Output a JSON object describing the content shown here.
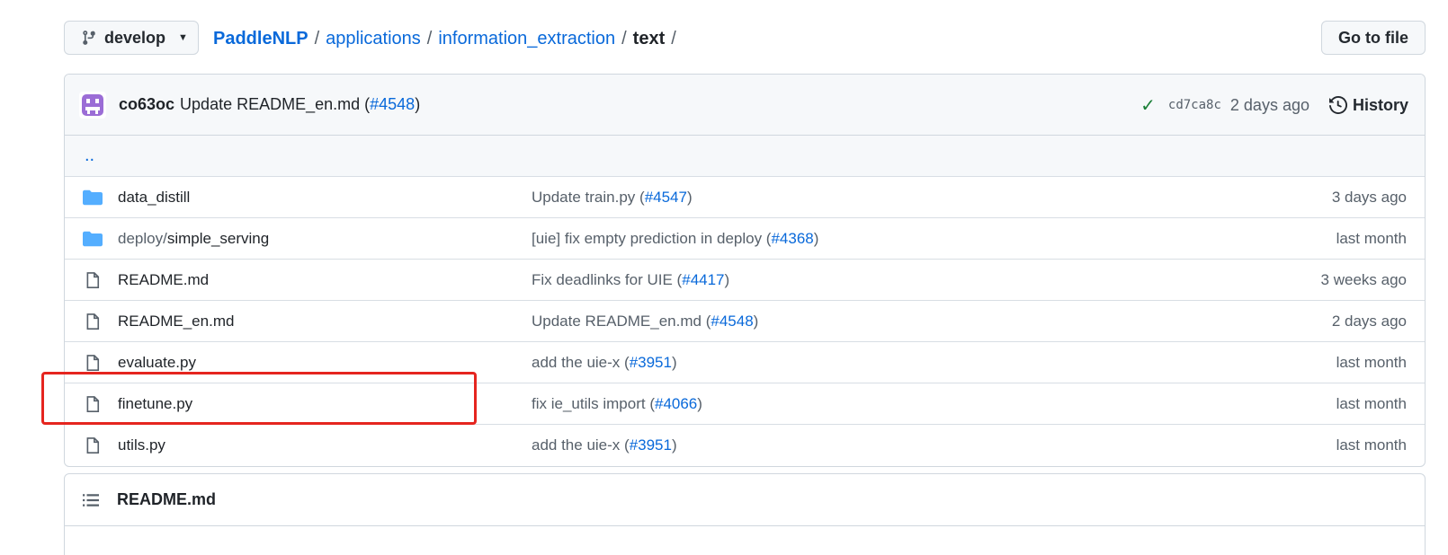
{
  "toolbar": {
    "branch": "develop",
    "breadcrumb": [
      "PaddleNLP",
      "applications",
      "information_extraction"
    ],
    "current": "text",
    "goto_label": "Go to file"
  },
  "commit": {
    "author": "co63oc",
    "message": "Update README_en.md (",
    "pr": "#4548",
    "message_end": ")",
    "sha": "cd7ca8c",
    "time": "2 days ago",
    "history_label": "History"
  },
  "parent_link": "..",
  "files": [
    {
      "type": "folder",
      "name_prefix": "",
      "name": "data_distill",
      "msg": "Update train.py (",
      "pr": "#4547",
      "time": "3 days ago"
    },
    {
      "type": "folder",
      "name_prefix": "deploy/",
      "name": "simple_serving",
      "msg": "[uie] fix empty prediction in deploy (",
      "pr": "#4368",
      "time": "last month"
    },
    {
      "type": "file",
      "name_prefix": "",
      "name": "README.md",
      "msg": "Fix deadlinks for UIE (",
      "pr": "#4417",
      "time": "3 weeks ago"
    },
    {
      "type": "file",
      "name_prefix": "",
      "name": "README_en.md",
      "msg": "Update README_en.md (",
      "pr": "#4548",
      "time": "2 days ago"
    },
    {
      "type": "file",
      "name_prefix": "",
      "name": "evaluate.py",
      "msg": "add the uie-x (",
      "pr": "#3951",
      "time": "last month"
    },
    {
      "type": "file",
      "name_prefix": "",
      "name": "finetune.py",
      "msg": "fix ie_utils import (",
      "pr": "#4066",
      "time": "last month"
    },
    {
      "type": "file",
      "name_prefix": "",
      "name": "utils.py",
      "msg": "add the uie-x (",
      "pr": "#3951",
      "time": "last month"
    }
  ],
  "readme": {
    "title": "README.md"
  },
  "colors": {
    "link": "#0969da",
    "highlight": "#e5251f",
    "folder": "#54aeff",
    "check": "#1a7f37"
  }
}
